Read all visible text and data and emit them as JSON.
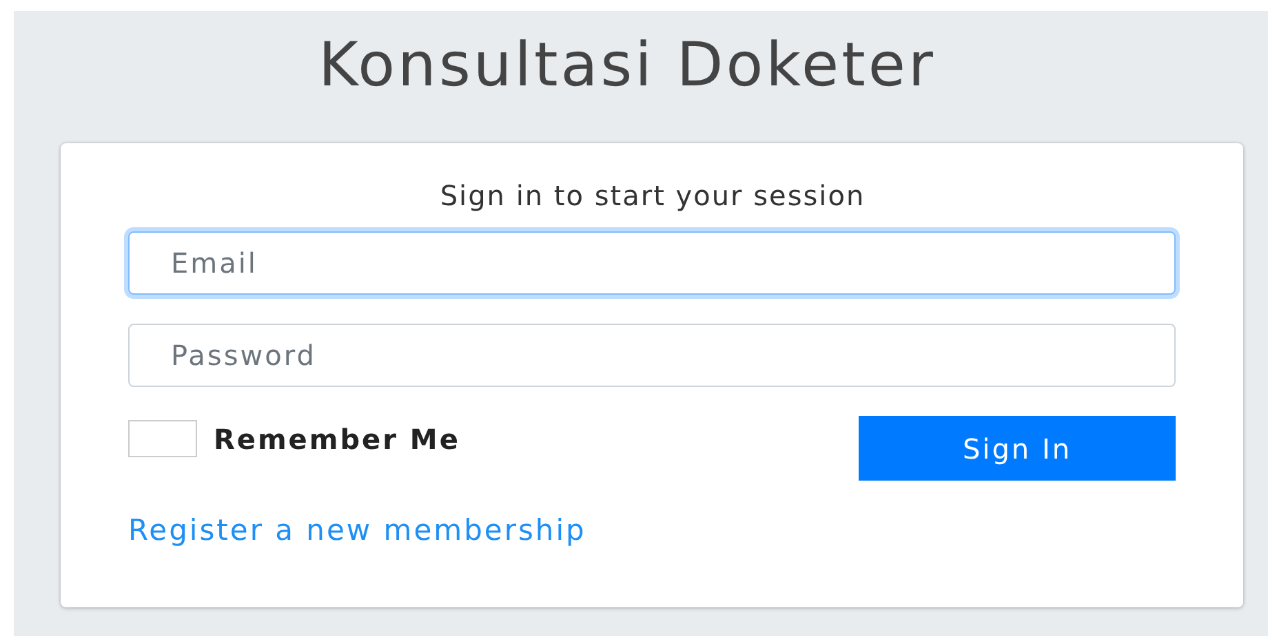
{
  "title": "Konsultasi Doketer",
  "card": {
    "heading": "Sign in to start your session"
  },
  "fields": [
    {
      "placeholder": "Email",
      "focused": true
    },
    {
      "placeholder": "Password",
      "focused": false
    }
  ],
  "remember": {
    "label": "Remember Me",
    "checked": false
  },
  "submit": {
    "label": "Sign In"
  },
  "register_link": "Register a new membership"
}
